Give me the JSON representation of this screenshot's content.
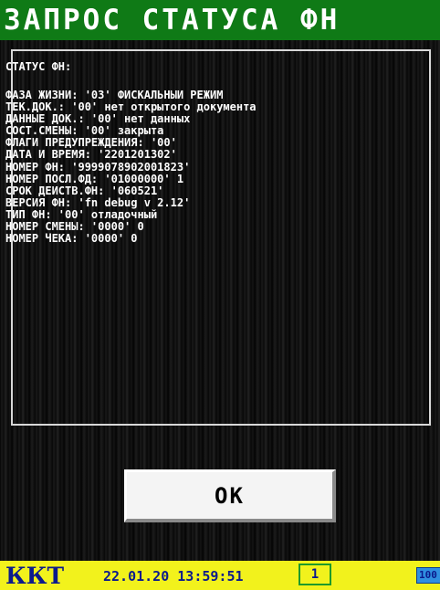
{
  "title": "ЗАПРОС СТАТУСА ФН",
  "panel": {
    "heading": "СТАТУС ФН:",
    "lines": [
      "ФАЗА ЖИЗНИ: '03' ФИСКАЛЬНЫЙ РЕЖИМ",
      "ТЕК.ДОК.: '00' нет открытого документа",
      "ДАННЫЕ ДОК.: '00' нет данных",
      "СОСТ.СМЕНЫ: '00' закрыта",
      "ФЛАГИ ПРЕДУПРЕЖДЕНИЯ: '00'",
      "ДАТА И ВРЕМЯ: '2201201302'",
      "НОМЕР ФН: '9999078902001823'",
      "НОМЕР ПОСЛ.ФД: '01000000' 1",
      "СРОК ДЕЙСТВ.ФН: '060521'",
      "ВЕРСИЯ ФН: 'fn debug v 2.12'",
      "ТИП ФН: '00' отладочный",
      "НОМЕР СМЕНЫ: '0000' 0",
      "НОМЕР ЧЕКА: '0000' 0"
    ]
  },
  "ok_button": {
    "label": "OK"
  },
  "status_bar": {
    "kkt_label": "ККТ",
    "datetime": "22.01.20 13:59:51",
    "shift_indicator": "1",
    "battery_text": "100",
    "battery_icon": "battery-icon"
  },
  "colors": {
    "title_bg": "#0f7a16",
    "status_bar_bg": "#f2f21c",
    "status_text": "#0b1a8c",
    "shift_border": "#1e9a2a",
    "battery_fill": "#2f8fe0"
  }
}
